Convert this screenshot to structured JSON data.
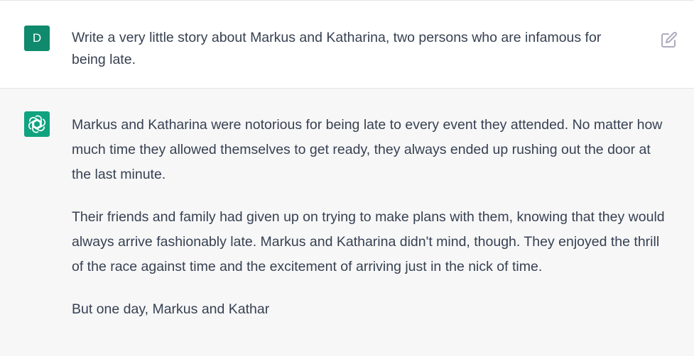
{
  "user_message": {
    "avatar_initial": "D",
    "text": "Write a very little story about Markus and Katharina, two persons who are infamous for being late."
  },
  "assistant_message": {
    "paragraphs": [
      "Markus and Katharina were notorious for being late to every event they attended. No matter how much time they allowed themselves to get ready, they always ended up rushing out the door at the last minute.",
      "Their friends and family had given up on trying to make plans with them, knowing that they would always arrive fashionably late. Markus and Katharina didn't mind, though. They enjoyed the thrill of the race against time and the excitement of arriving just in the nick of time.",
      "But one day, Markus and Kathar"
    ]
  },
  "icons": {
    "edit": "pencil-square-icon",
    "assistant_avatar": "openai-logo-icon"
  },
  "colors": {
    "user_avatar": "#0f8a6c",
    "assistant_avatar": "#10a37f",
    "assistant_bg": "#f7f7f8",
    "text": "#374151"
  }
}
